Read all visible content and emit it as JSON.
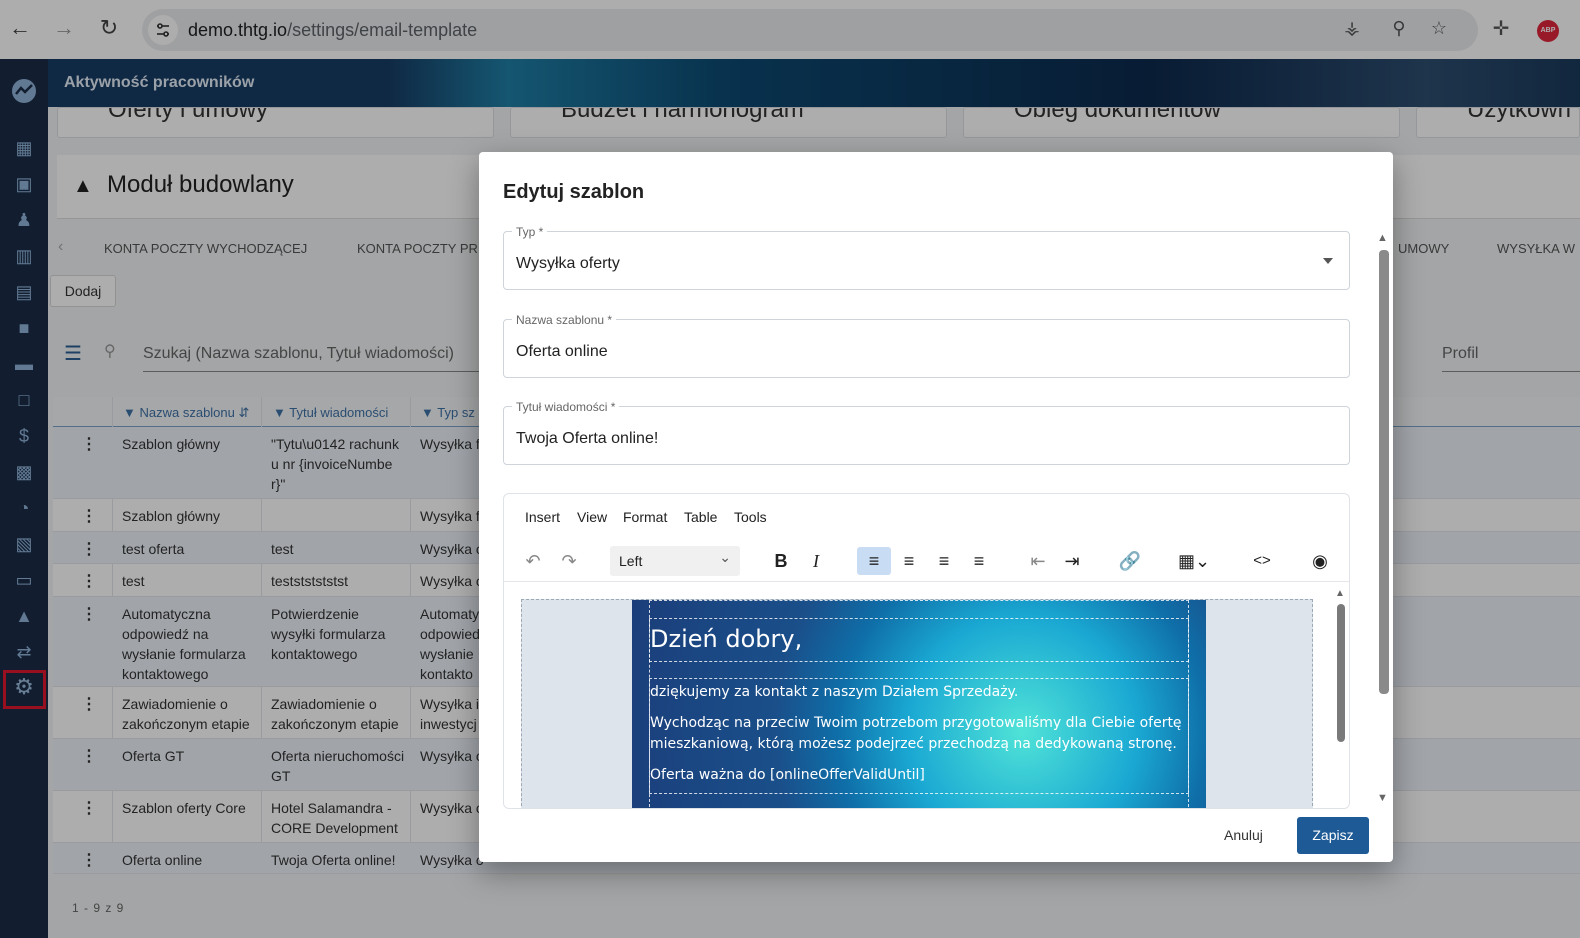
{
  "browser": {
    "url_host": "demo.thtg.io",
    "url_path": "/settings/email-template",
    "abp_label": "ABP"
  },
  "app": {
    "header_title": "Aktywność pracowników",
    "cards": [
      "Oferty i umowy",
      "Budżet i harmonogram",
      "Obieg dokumentów",
      "Użytkown"
    ],
    "module_title": "Moduł budowlany",
    "tabs": [
      "KONTA POCZTY WYCHODZĄCEJ",
      "KONTA POCZTY PR",
      "UMOWY",
      "WYSYŁKA W"
    ],
    "add_button": "Dodaj",
    "search_placeholder": "Szukaj (Nazwa szablonu, Tytuł wiadomości)",
    "profile_label": "Profil",
    "table": {
      "columns": [
        "Nazwa szablonu",
        "Tytuł wiadomości",
        "Typ sz"
      ],
      "rows": [
        {
          "name": "Szablon główny",
          "title": "\"Tytu\\u0142 rachunku nr {invoiceNumber}\"",
          "type": "Wysyłka f"
        },
        {
          "name": "Szablon główny",
          "title": "",
          "type": "Wysyłka f"
        },
        {
          "name": "test oferta",
          "title": "test",
          "type": "Wysyłka o"
        },
        {
          "name": "test",
          "title": "testststststst",
          "type": "Wysyłka o"
        },
        {
          "name": "Automatyczna odpowiedź na wysłanie formularza kontaktowego",
          "title": "Potwierdzenie wysyłki formularza kontaktowego",
          "type": "Automaty odpowied wysłanie kontakto"
        },
        {
          "name": "Zawiadomienie o zakończonym etapie",
          "title": "Zawiadomienie o zakończonym etapie",
          "type": "Wysyłka i inwestycj"
        },
        {
          "name": "Oferta GT",
          "title": "Oferta nieruchomości GT",
          "type": "Wysyłka o"
        },
        {
          "name": "Szablon oferty Core",
          "title": "Hotel Salamandra - CORE Development",
          "type": "Wysyłka o"
        },
        {
          "name": "Oferta online",
          "title": "Twoja Oferta online!",
          "type": "Wysyłka o"
        }
      ],
      "pagination": "1 - 9 z 9"
    }
  },
  "dialog": {
    "title": "Edytuj szablon",
    "type_label": "Typ *",
    "type_value": "Wysyłka oferty",
    "name_label": "Nazwa szablonu *",
    "name_value": "Oferta online",
    "subject_label": "Tytuł wiadomości *",
    "subject_value": "Twoja Oferta online!",
    "editor_menu": [
      "Insert",
      "View",
      "Format",
      "Table",
      "Tools"
    ],
    "align_select": "Left",
    "email": {
      "greeting": "Dzień dobry,",
      "line1": "dziękujemy za kontakt z naszym Działem Sprzedaży.",
      "line2a": "Wychodząc na przeciw Twoim potrzebom przygotowaliśmy dla Ciebie ofertę",
      "line2b": "mieszkaniową, którą możesz podejrzeć przechodzą na dedykowaną stronę.",
      "line3": "Oferta ważna do [onlineOfferValidUntil]"
    },
    "cancel": "Anuluj",
    "save": "Zapisz"
  },
  "colors": {
    "sidebar": "#1b2d47",
    "primary": "#1d5a96",
    "active_marker": "#e0192f"
  }
}
